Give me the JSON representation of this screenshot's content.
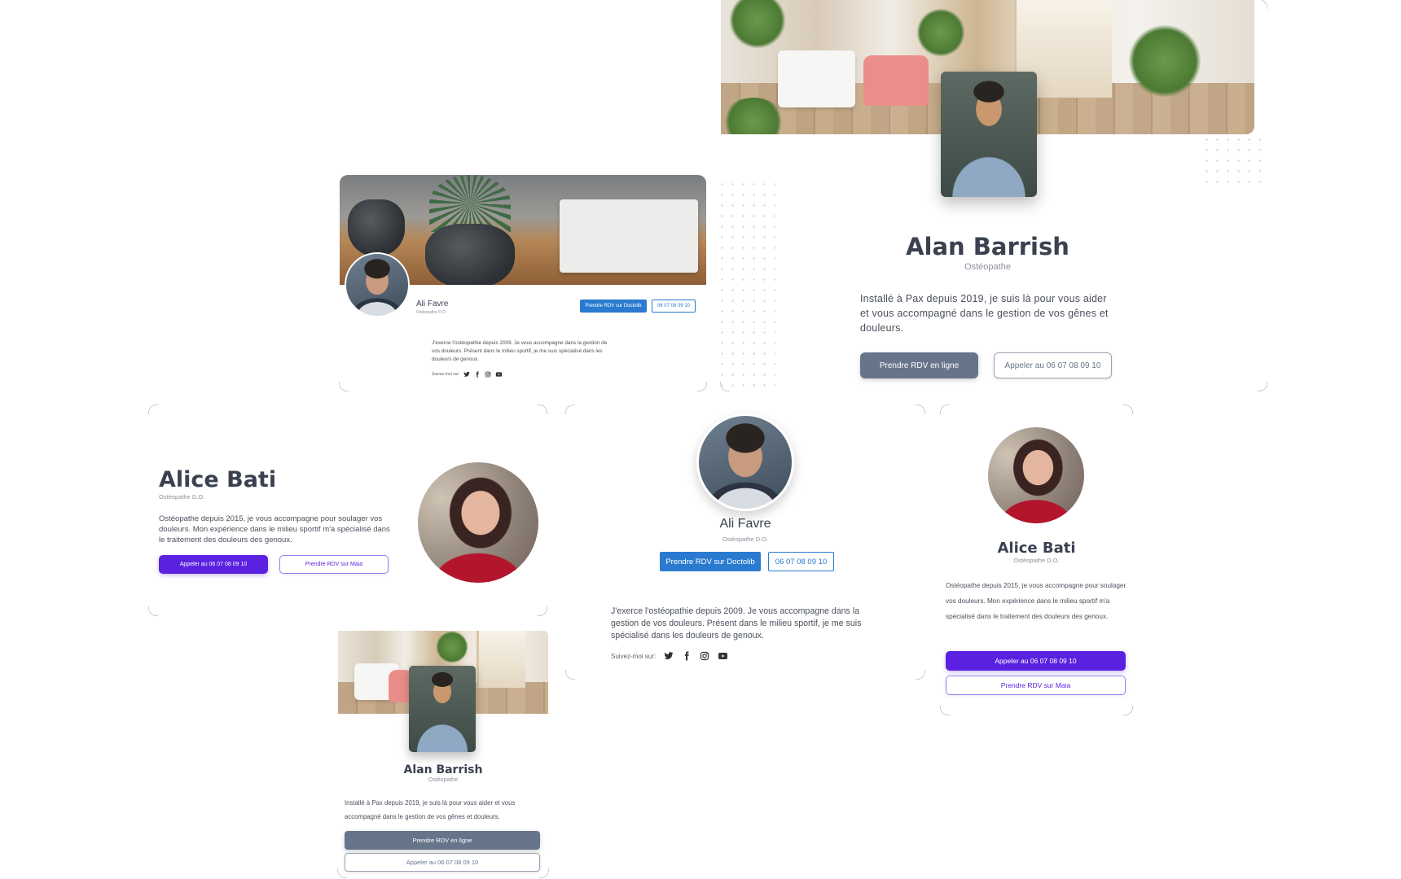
{
  "cards": {
    "alan_large": {
      "name": "Alan Barrish",
      "title": "Ostéopathe",
      "bio": "Installé à Pax depuis 2019, je suis là pour vous aider et vous accompagné dans le gestion de vos gênes et douleurs.",
      "primary_button": "Prendre RDV en ligne",
      "secondary_button": "Appeler au 06 07 08 09 10"
    },
    "ali_banner": {
      "name": "Ali Favre",
      "title": "Ostéopathe D.O.",
      "primary_button": "Prendre RDV sur Doctolib",
      "secondary_button": "06 07 08 09 10",
      "bio": "J'exerce l'ostéopathie depuis 2009. Je vous accompagne dans la gestion de vos douleurs. Présent dans le milieu sportif, je me suis spécialisé dans les douleurs de genoux.",
      "follow_label": "Suivez-moi sur:"
    },
    "alice_wide": {
      "name": "Alice Bati",
      "title": "Ostéopathe D.O.",
      "bio": "Ostéopathe depuis 2015, je vous accompagne pour soulager vos douleurs. Mon expérience dans le milieu sportif m'a spécialisé dans le traitement des douleurs des genoux.",
      "primary_button": "Appeler au 06 07 08 09 10",
      "secondary_button": "Prendre RDV sur Maia"
    },
    "ali_center": {
      "name": "Ali Favre",
      "title": "Ostéopathe D.O.",
      "primary_button": "Prendre RDV sur Doctolib",
      "secondary_button": "06 07 08 09 10",
      "bio": "J'exerce l'ostéopathie depuis 2009. Je vous accompagne dans la gestion de vos douleurs. Présent dans le milieu sportif, je me suis spécialisé dans les douleurs de genoux.",
      "follow_label": "Suivez-moi sur:"
    },
    "alice_narrow": {
      "name": "Alice Bati",
      "title": "Ostéopathe D.O.",
      "bio": "Ostéopathe depuis 2015, je vous accompagne pour soulager vos douleurs. Mon expérience dans le milieu sportif m'a spécialisé dans le traitement des douleurs des genoux.",
      "primary_button": "Appeler au 06 07 08 09 10",
      "secondary_button": "Prendre RDV sur Maia"
    },
    "alan_small": {
      "name": "Alan Barrish",
      "title": "Ostéopathe",
      "bio": "Installé à Pax depuis 2019, je suis là pour vous aider et vous accompagné dans le gestion de vos gênes et douleurs.",
      "primary_button": "Prendre RDV en ligne",
      "secondary_button": "Appeler au 06 07 08 09 10"
    }
  },
  "social_icons": [
    "twitter-icon",
    "facebook-icon",
    "instagram-icon",
    "youtube-icon"
  ],
  "colors": {
    "slate": "#67758a",
    "blue": "#2a7bd0",
    "purple": "#5a22e0",
    "text": "#3b4150"
  }
}
